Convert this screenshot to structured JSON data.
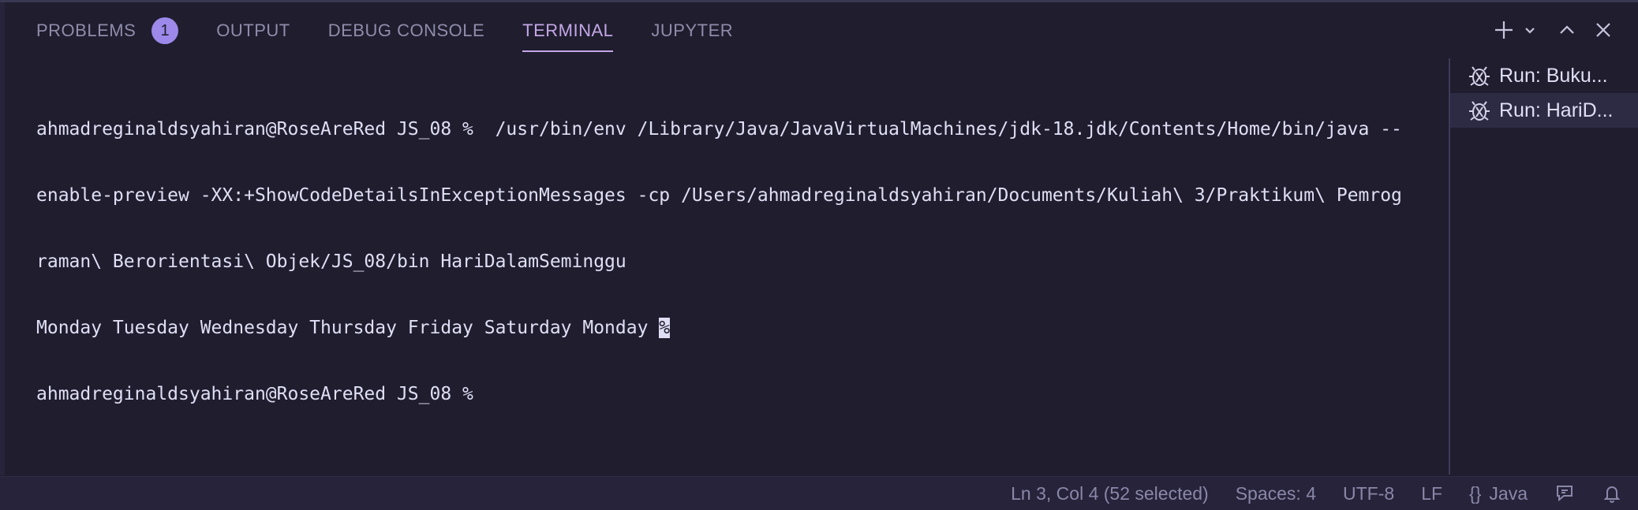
{
  "tabs": [
    {
      "label": "PROBLEMS",
      "badge": "1"
    },
    {
      "label": "OUTPUT"
    },
    {
      "label": "DEBUG CONSOLE"
    },
    {
      "label": "TERMINAL",
      "active": true
    },
    {
      "label": "JUPYTER"
    }
  ],
  "terminal": {
    "lines": [
      "ahmadreginaldsyahiran@RoseAreRed JS_08 %  /usr/bin/env /Library/Java/JavaVirtualMachines/jdk-18.jdk/Contents/Home/bin/java --",
      "enable-preview -XX:+ShowCodeDetailsInExceptionMessages -cp /Users/ahmadreginaldsyahiran/Documents/Kuliah\\ 3/Praktikum\\ Pemrog",
      "raman\\ Berorientasi\\ Objek/JS_08/bin HariDalamSeminggu"
    ],
    "output_line": "Monday Tuesday Wednesday Thursday Friday Saturday Monday ",
    "output_marker": "%",
    "prompt": "ahmadreginaldsyahiran@RoseAreRed JS_08 % "
  },
  "sessions": [
    {
      "label": "Run: Buku...",
      "icon": "debug-bug-icon"
    },
    {
      "label": "Run: HariD...",
      "icon": "debug-bug-icon",
      "selected": true
    }
  ],
  "status": {
    "cursor": "Ln 3, Col 4 (52 selected)",
    "spaces": "Spaces: 4",
    "encoding": "UTF-8",
    "eol": "LF",
    "language_braces": "{}",
    "language": "Java"
  },
  "colors": {
    "background": "#1f1d2e",
    "accent": "#c4a7e7",
    "badge": "#9c89e9",
    "text": "#e0def4",
    "muted": "#908caa"
  }
}
